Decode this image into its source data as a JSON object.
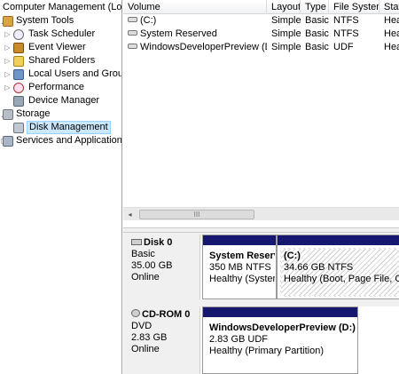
{
  "tree": {
    "root": "Computer Management (Local",
    "system_tools": "System Tools",
    "task_scheduler": "Task Scheduler",
    "event_viewer": "Event Viewer",
    "shared_folders": "Shared Folders",
    "local_users": "Local Users and Groups",
    "performance": "Performance",
    "device_manager": "Device Manager",
    "storage": "Storage",
    "disk_management": "Disk Management",
    "services": "Services and Applications"
  },
  "columns": [
    "Volume",
    "Layout",
    "Type",
    "File System",
    "Stat"
  ],
  "volumes": [
    {
      "volume": "(C:)",
      "layout": "Simple",
      "type": "Basic",
      "fs": "NTFS",
      "status": "Hea"
    },
    {
      "volume": "System Reserved",
      "layout": "Simple",
      "type": "Basic",
      "fs": "NTFS",
      "status": "Hea"
    },
    {
      "volume": "WindowsDeveloperPreview (D:)",
      "layout": "Simple",
      "type": "Basic",
      "fs": "UDF",
      "status": "Hea"
    }
  ],
  "scrollbar": {
    "left_arrow": "◂",
    "grip": "III"
  },
  "disks": [
    {
      "name": "Disk 0",
      "type": "Basic",
      "size": "35.00 GB",
      "state": "Online",
      "partitions": [
        {
          "name": "System Reserv",
          "detail": "350 MB NTFS",
          "status": "Healthy (System"
        },
        {
          "name": "(C:)",
          "detail": "34.66 GB NTFS",
          "status": "Healthy (Boot, Page File, Crash"
        }
      ]
    },
    {
      "name": "CD-ROM 0",
      "type": "DVD",
      "size": "2.83 GB",
      "state": "Online",
      "partitions": [
        {
          "name": "WindowsDeveloperPreview  (D:)",
          "detail": "2.83 GB UDF",
          "status": "Healthy (Primary Partition)"
        }
      ]
    }
  ]
}
